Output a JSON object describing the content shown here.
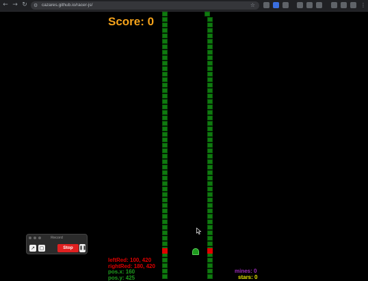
{
  "browser": {
    "url": "cazares.github.io/racer-js/",
    "back_icon": "arrow-left-icon",
    "forward_icon": "arrow-right-icon",
    "reload_icon": "reload-icon",
    "bookmark_icon": "star-icon"
  },
  "game": {
    "score_text": "Score: 0",
    "hud": {
      "left_red": "leftRed: 100, 420",
      "right_red": "rightRed: 180, 420",
      "pos_x": "pos.x: 160",
      "pos_y": "pos.y: 425",
      "mines": "mines: 0",
      "stars": "stars: 0"
    },
    "colors": {
      "score": "#f4a21b",
      "wall": "#0f7a0f",
      "red_marker": "#e00000",
      "red_text": "#e00000",
      "green_text": "#1f9d1f",
      "mines_text": "#9b2bb8",
      "stars_text": "#e6e600"
    }
  },
  "record_widget": {
    "title": "Record",
    "stop_label": "Stop",
    "pause_label": "❚❚"
  }
}
